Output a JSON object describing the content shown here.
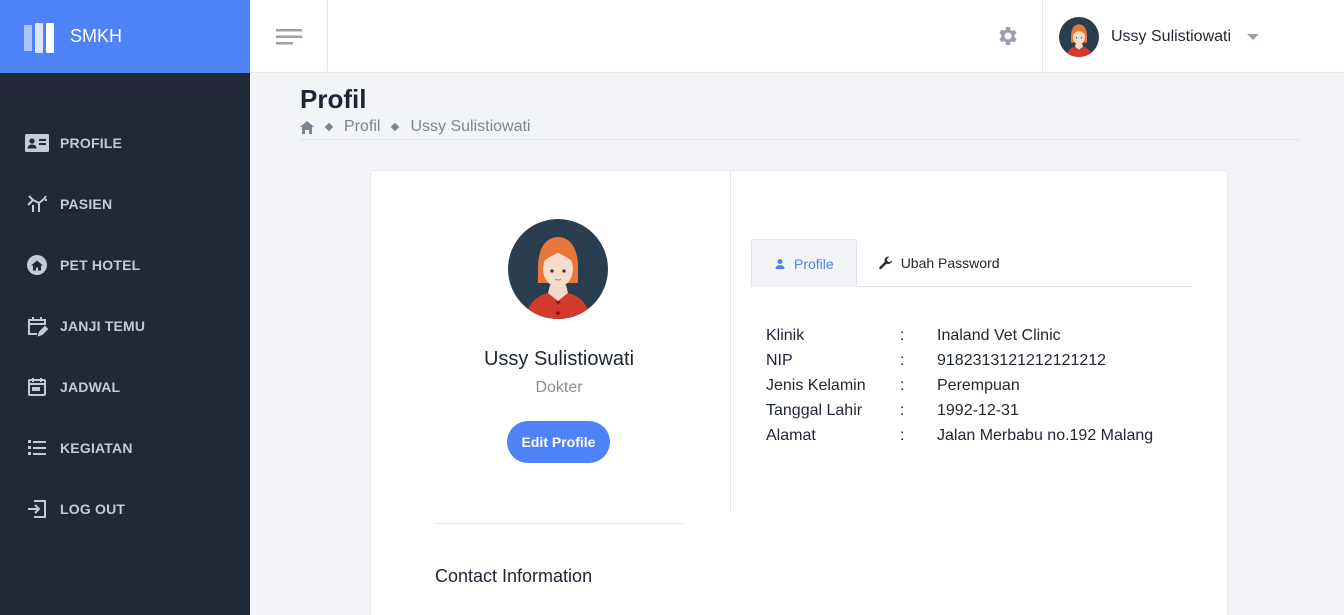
{
  "brand": {
    "name": "SMKH"
  },
  "sidebar": {
    "items": [
      {
        "label": "PROFILE",
        "icon": "id-card-icon"
      },
      {
        "label": "PASIEN",
        "icon": "pet-icon"
      },
      {
        "label": "PET HOTEL",
        "icon": "home-icon"
      },
      {
        "label": "JANJI TEMU",
        "icon": "calendar-edit-icon"
      },
      {
        "label": "JADWAL",
        "icon": "calendar-icon"
      },
      {
        "label": "KEGIATAN",
        "icon": "list-icon"
      },
      {
        "label": "LOG OUT",
        "icon": "logout-icon"
      }
    ]
  },
  "topbar": {
    "user_name": "Ussy Sulistiowati"
  },
  "page": {
    "title": "Profil",
    "breadcrumb": [
      "Profil",
      "Ussy Sulistiowati"
    ]
  },
  "profile": {
    "name": "Ussy Sulistiowati",
    "role": "Dokter",
    "edit_label": "Edit Profile",
    "contact_heading": "Contact Information"
  },
  "tabs": [
    {
      "label": "Profile",
      "active": true
    },
    {
      "label": "Ubah Password",
      "active": false
    }
  ],
  "details": {
    "separator": ":",
    "rows": [
      {
        "key": "Klinik",
        "value": "Inaland Vet Clinic"
      },
      {
        "key": "NIP",
        "value": "9182313121212121212"
      },
      {
        "key": "Jenis Kelamin",
        "value": "Perempuan"
      },
      {
        "key": "Tanggal Lahir",
        "value": "1992-12-31"
      },
      {
        "key": "Alamat",
        "value": "Jalan Merbabu no.192 Malang"
      }
    ]
  },
  "colors": {
    "accent": "#4f82f7",
    "sidebar": "#222936",
    "background": "#f2f4f8"
  }
}
